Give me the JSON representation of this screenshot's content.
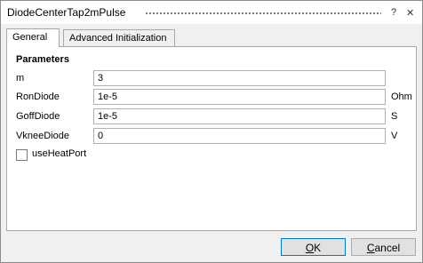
{
  "window": {
    "title": "DiodeCenterTap2mPulse",
    "help_glyph": "?",
    "close_glyph": "✕"
  },
  "tabs": [
    {
      "label": "General"
    },
    {
      "label": "Advanced Initialization"
    }
  ],
  "parameters": {
    "section_title": "Parameters",
    "rows": [
      {
        "label": "m",
        "value": "3",
        "unit": ""
      },
      {
        "label": "RonDiode",
        "value": "1e-5",
        "unit": "Ohm"
      },
      {
        "label": "GoffDiode",
        "value": "1e-5",
        "unit": "S"
      },
      {
        "label": "VkneeDiode",
        "value": "0",
        "unit": "V"
      }
    ],
    "use_heat_port": {
      "label": "useHeatPort",
      "checked": false
    }
  },
  "buttons": {
    "ok_mnemonic": "O",
    "ok_rest": "K",
    "cancel_mnemonic": "C",
    "cancel_rest": "ancel"
  }
}
